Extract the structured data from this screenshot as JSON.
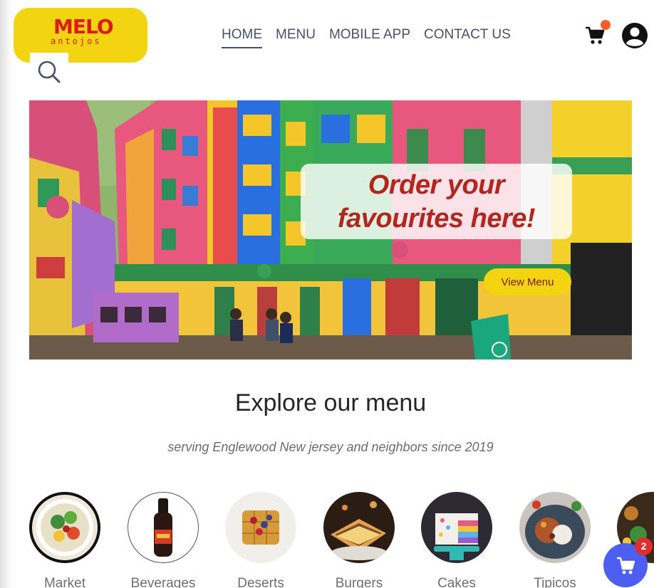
{
  "brand": {
    "name": "MELO",
    "tagline": "antojos"
  },
  "nav": {
    "items": [
      {
        "label": "HOME"
      },
      {
        "label": "MENU"
      },
      {
        "label": "MOBILE APP"
      },
      {
        "label": "CONTACT US"
      }
    ],
    "active": "HOME"
  },
  "icons": {
    "search": "search-icon",
    "cart": "cart-icon",
    "profile": "user-circle-icon",
    "floating_cart": "cart-icon"
  },
  "hero": {
    "title_line1": "Order your",
    "title_line2": "favourites here!",
    "button_label": "View Menu"
  },
  "explore": {
    "title": "Explore our menu",
    "subtitle": "serving Englewood New jersey and neighbors since 2019",
    "categories": [
      {
        "label": "Market"
      },
      {
        "label": "Beverages"
      },
      {
        "label": "Deserts"
      },
      {
        "label": "Burgers"
      },
      {
        "label": "Cakes"
      },
      {
        "label": "Tipicos"
      }
    ]
  },
  "cart": {
    "badge_count": "2"
  },
  "colors": {
    "brand_yellow": "#f3d410",
    "brand_red": "#e01a1a",
    "nav_text": "#4b5068",
    "cart_dot": "#ff5a2c",
    "floating_cart": "#4c5ff0",
    "badge": "#e32c2c"
  }
}
